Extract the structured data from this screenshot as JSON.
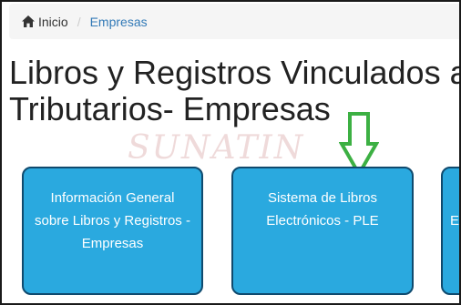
{
  "breadcrumb": {
    "home_label": "Inicio",
    "separator": "/",
    "current_label": "Empresas"
  },
  "page": {
    "title_line1": "Libros y Registros Vinculados a",
    "title_line2": "Tributarios- Empresas"
  },
  "watermark": {
    "text": "SUNATIN"
  },
  "cards": [
    {
      "label": "Información General sobre Libros y Registros - Empresas"
    },
    {
      "label": "Sistema de Libros Electrónicos - PLE"
    },
    {
      "label": "E"
    }
  ],
  "colors": {
    "card_fill": "#2aa9df",
    "card_border": "#0f4a6e",
    "link": "#337ab7",
    "arrow": "#3cb043"
  },
  "icons": {
    "home": "home-icon",
    "arrow": "down-arrow-icon"
  }
}
